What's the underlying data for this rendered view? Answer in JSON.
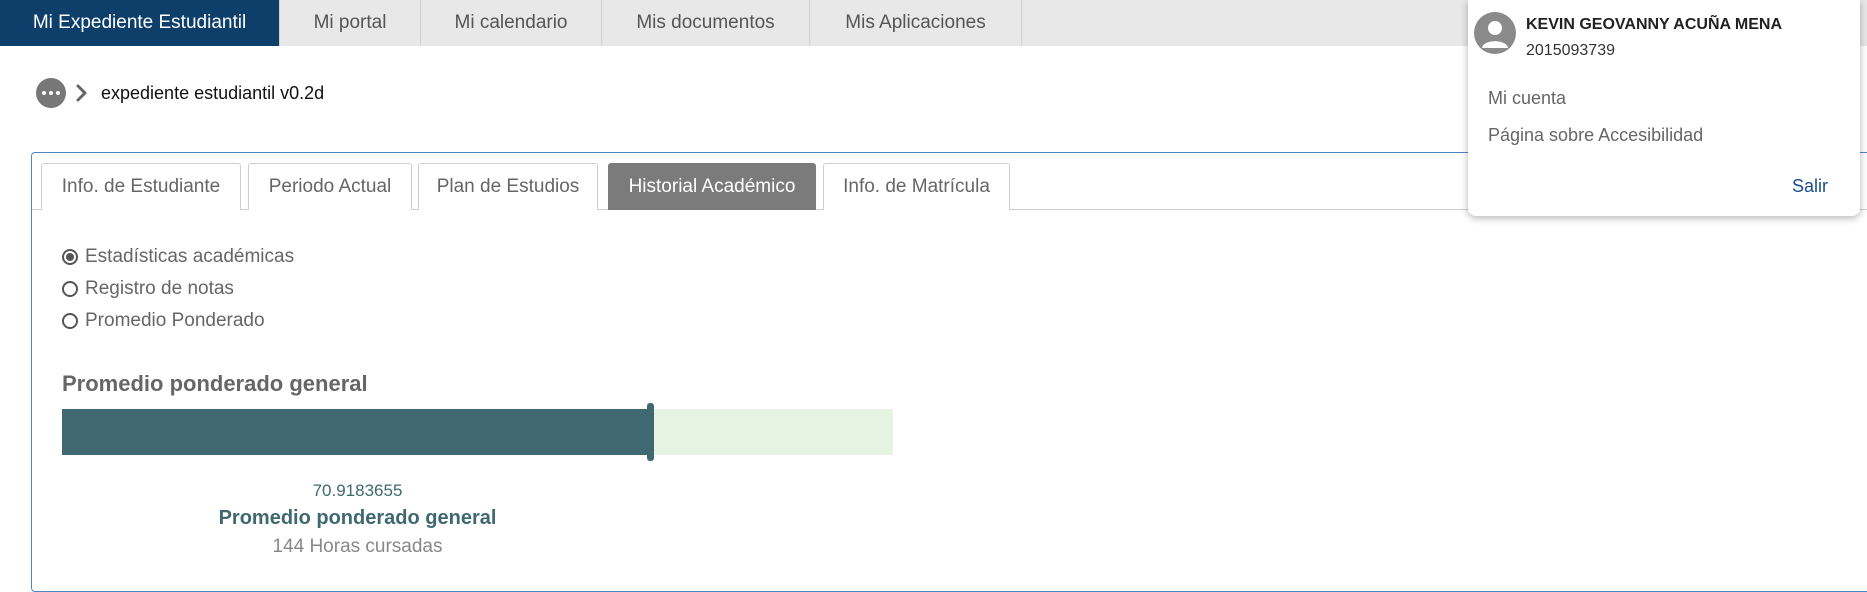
{
  "topnav": {
    "tabs": [
      {
        "label": "Mi Expediente Estudiantil",
        "active": true
      },
      {
        "label": "Mi portal"
      },
      {
        "label": "Mi calendario"
      },
      {
        "label": "Mis documentos"
      },
      {
        "label": "Mis Aplicaciones"
      }
    ]
  },
  "breadcrumb": {
    "title": "expediente estudiantil v0.2d",
    "icons": [
      "more-icon",
      "chevron-right-icon"
    ]
  },
  "panel": {
    "tabs": [
      {
        "label": "Info. de Estudiante"
      },
      {
        "label": "Periodo Actual"
      },
      {
        "label": "Plan de Estudios"
      },
      {
        "label": "Historial Académico",
        "active": true
      },
      {
        "label": "Info. de Matrícula"
      }
    ],
    "radios": [
      {
        "label": "Estadísticas académicas",
        "selected": true
      },
      {
        "label": "Registro de notas"
      },
      {
        "label": "Promedio Ponderado"
      }
    ],
    "section_title": "Promedio ponderado general",
    "progress": {
      "value": 70.9183655,
      "max": 100,
      "value_text": "70.9183655",
      "label": "Promedio ponderado general",
      "hours_text": "144 Horas cursadas"
    }
  },
  "user_menu": {
    "name": "KEVIN GEOVANNY ACUÑA MENA",
    "id": "2015093739",
    "links": [
      "Mi cuenta",
      "Página sobre Accesibilidad"
    ],
    "logout": "Salir"
  },
  "colors": {
    "nav_active": "#0e3f6b",
    "tab_active": "#7b7b7b",
    "bar_fill": "#3f6870",
    "bar_track": "#e6f2e2",
    "panel_border": "#4a86c5",
    "logout_link": "#1a4f8a"
  }
}
